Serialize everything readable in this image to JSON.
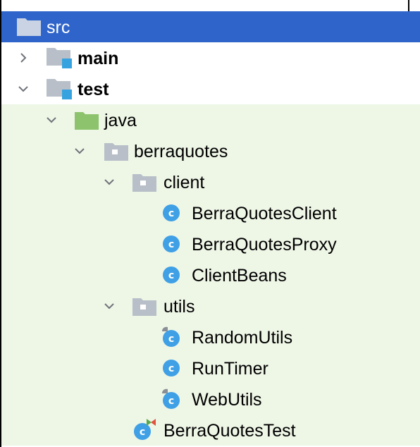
{
  "tree": {
    "src": "src",
    "main": "main",
    "test": "test",
    "java": "java",
    "berraquotes": "berraquotes",
    "client": "client",
    "client_classes": [
      "BerraQuotesClient",
      "BerraQuotesProxy",
      "ClientBeans"
    ],
    "utils": "utils",
    "utils_classes": [
      "RandomUtils",
      "RunTimer",
      "WebUtils"
    ],
    "test_class": "BerraQuotesTest"
  },
  "icons": {
    "folder": "folder-icon",
    "module_folder": "module-folder-icon",
    "source_root": "test-source-root-icon",
    "package": "package-icon",
    "class": "class-icon",
    "test_class": "test-class-icon"
  },
  "colors": {
    "selection": "#2f65ca",
    "test_tint": "#eef6e6",
    "class_icon": "#3fa0e6",
    "source_root_folder": "#8cc36c",
    "package_folder": "#b8bfc8",
    "module_badge": "#36a3e0"
  }
}
